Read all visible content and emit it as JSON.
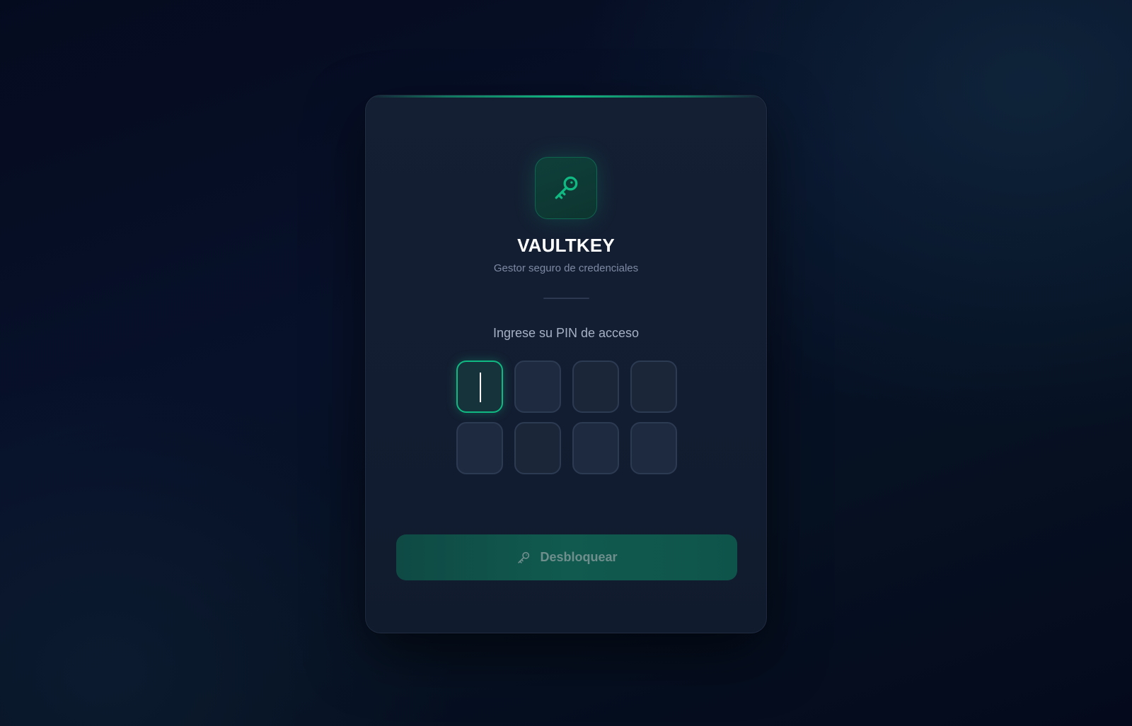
{
  "app": {
    "name": "VAULTKEY",
    "tagline": "Gestor seguro de credenciales",
    "logo_icon": "key-icon",
    "accent_color": "#10b981"
  },
  "pin": {
    "prompt": "Ingrese su PIN de acceso",
    "length": 8,
    "active_index": 0
  },
  "unlock_button": {
    "label": "Desbloquear",
    "icon": "key-icon",
    "state": "disabled"
  }
}
